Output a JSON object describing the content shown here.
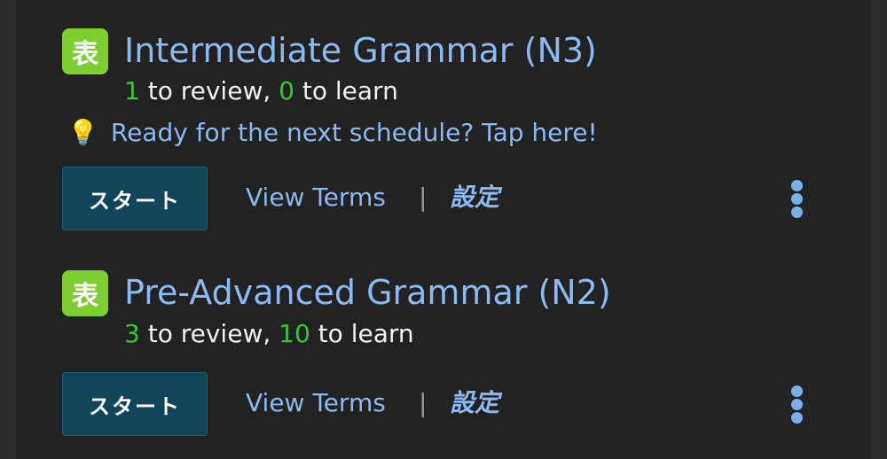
{
  "decks": [
    {
      "icon_glyph": "表",
      "title": "Intermediate Grammar (N3)",
      "review_count": "1",
      "review_text": " to review, ",
      "learn_count": "0",
      "learn_text": " to learn",
      "hint_text": "Ready for the next schedule? Tap here!",
      "start_label": "スタート",
      "view_terms_label": "View Terms",
      "separator": "|",
      "settings_label": "設定"
    },
    {
      "icon_glyph": "表",
      "title": "Pre-Advanced Grammar (N2)",
      "review_count": "3",
      "review_text": " to review, ",
      "learn_count": "10",
      "learn_text": " to learn",
      "start_label": "スタート",
      "view_terms_label": "View Terms",
      "separator": "|",
      "settings_label": "設定"
    }
  ],
  "icons": {
    "deck": "kanji-card-icon",
    "hint": "lightbulb-icon",
    "hint_glyph": "💡",
    "more": "more-vertical-icon"
  },
  "colors": {
    "background": "#222222",
    "accent": "#8bb9f0",
    "count": "#3cc13c",
    "deck_icon": "#7ccf2e",
    "start_button": "#11465a"
  }
}
